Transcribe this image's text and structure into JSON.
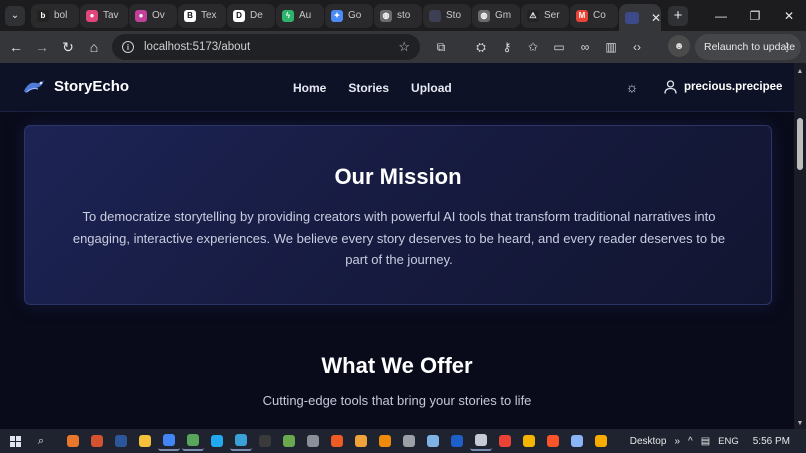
{
  "browser": {
    "tabs": [
      {
        "label": "bol",
        "icon": "b-icon",
        "color": "#222222",
        "glyph": "b"
      },
      {
        "label": "Tav",
        "icon": "tavily-icon",
        "color": "#e0457b",
        "glyph": "●"
      },
      {
        "label": "Ov",
        "icon": "record-icon",
        "color": "#c0409a",
        "glyph": "●"
      },
      {
        "label": "Tex",
        "icon": "notebook-icon",
        "color": "#ffffff",
        "glyph": "B"
      },
      {
        "label": "De",
        "icon": "d-icon",
        "color": "#ffffff",
        "glyph": "D"
      },
      {
        "label": "Au",
        "icon": "bolt-icon",
        "color": "#2db36b",
        "glyph": "ϟ"
      },
      {
        "label": "Go",
        "icon": "gemini-icon",
        "color": "#4c8bf5",
        "glyph": "✦"
      },
      {
        "label": "sto",
        "icon": "globe-icon",
        "color": "#6b6b6b",
        "glyph": "◍"
      },
      {
        "label": "Sto",
        "icon": "storyecho-favicon",
        "color": "#3d3f52",
        "glyph": ""
      },
      {
        "label": "Gm",
        "icon": "globe-icon",
        "color": "#6b6b6b",
        "glyph": "◍"
      },
      {
        "label": "Ser",
        "icon": "triangle-icon",
        "color": "#222222",
        "glyph": "⚠"
      },
      {
        "label": "Co",
        "icon": "gmail-icon",
        "color": "#ea4335",
        "glyph": "M"
      }
    ],
    "active_tab_icon": "storyecho-favicon",
    "url": "localhost:5173/about",
    "relaunch_label": "Relaunch to update"
  },
  "header": {
    "brand": "StoryEcho",
    "nav": [
      "Home",
      "Stories",
      "Upload"
    ],
    "username": "precious.precipee"
  },
  "mission": {
    "title": "Our Mission",
    "text": "To democratize storytelling by providing creators with powerful AI tools that transform traditional narratives into engaging, interactive experiences. We believe every story deserves to be heard, and every reader deserves to be part of the journey."
  },
  "offer": {
    "title": "What We Offer",
    "subtitle": "Cutting-edge tools that bring your stories to life"
  },
  "taskbar": {
    "desktop_label": "Desktop",
    "language": "ENG",
    "time": "5:56 PM",
    "apps": [
      {
        "name": "search-app-icon",
        "color": "#e8762b"
      },
      {
        "name": "powerpoint-icon",
        "color": "#d35230"
      },
      {
        "name": "word-icon",
        "color": "#2b579a"
      },
      {
        "name": "file-explorer-icon",
        "color": "#f3c13a"
      },
      {
        "name": "chrome-icon",
        "color": "#4285f4"
      },
      {
        "name": "notepad-icon",
        "color": "#58a55c"
      },
      {
        "name": "vscode-icon",
        "color": "#23a9f2"
      },
      {
        "name": "photos-icon",
        "color": "#3aa0d8"
      },
      {
        "name": "terminal-icon",
        "color": "#3a3a3a"
      },
      {
        "name": "git-icon",
        "color": "#6aa84f"
      },
      {
        "name": "database-icon",
        "color": "#8a8f98"
      },
      {
        "name": "postman-icon",
        "color": "#ef5b25"
      },
      {
        "name": "sublime-icon",
        "color": "#f0a33a"
      },
      {
        "name": "vlc-icon",
        "color": "#f08a0b"
      },
      {
        "name": "calculator-icon",
        "color": "#9aa0a6"
      },
      {
        "name": "scanner-icon",
        "color": "#7fb2e5"
      },
      {
        "name": "t-app-icon",
        "color": "#1e60c9"
      },
      {
        "name": "remote-desktop-icon",
        "color": "#c4cbd6"
      },
      {
        "name": "chrome-alt-icon",
        "color": "#ea4335"
      },
      {
        "name": "triangle-app-icon",
        "color": "#f4b400"
      },
      {
        "name": "brave-icon",
        "color": "#fb542b"
      },
      {
        "name": "notes-icon",
        "color": "#8ab4f8"
      },
      {
        "name": "chrome-canary-icon",
        "color": "#f9ab00"
      }
    ]
  }
}
